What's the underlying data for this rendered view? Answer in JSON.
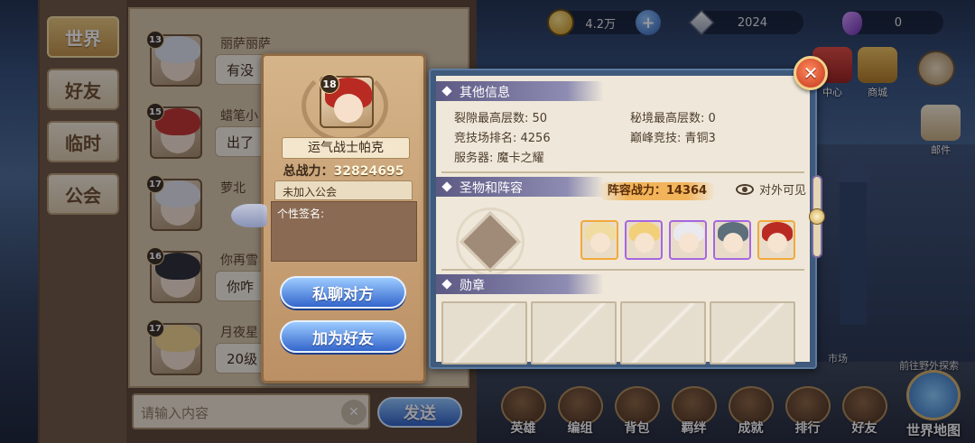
{
  "top_bar": {
    "gold": "4.2万",
    "diamonds": "2024",
    "purple_currency": "0"
  },
  "chat": {
    "tabs": [
      "世界",
      "好友",
      "临时",
      "公会"
    ],
    "active_tab_index": 0,
    "messages": [
      {
        "level": "13",
        "name": "丽萨丽萨",
        "text": "有没",
        "hair_color": "#dfe3ea"
      },
      {
        "level": "15",
        "name": "蜡笔小",
        "text": "出了",
        "hair_color": "#c4332b"
      },
      {
        "level": "17",
        "name": "萝北",
        "text": "",
        "hair_color": "#e4e4ea"
      },
      {
        "level": "16",
        "name": "你再雪",
        "text": "你咋",
        "hair_color": "#2c2c34"
      },
      {
        "level": "17",
        "name": "月夜星",
        "text": "20级",
        "hair_color": "#f1d58a"
      }
    ],
    "input_placeholder": "请输入内容",
    "send_label": "发送"
  },
  "profile": {
    "level": "18",
    "name": "运气战士帕克",
    "power_label": "总战力：",
    "power_value": "32824695",
    "guild": "未加入公会",
    "signature_label": "个性签名:",
    "private_chat_label": "私聊对方",
    "add_friend_label": "加为好友"
  },
  "info": {
    "other_title": "其他信息",
    "stats": {
      "rift_label": "裂隙最高层数: 50",
      "secret_label": "秘境最高层数: 0",
      "arena_label": "竞技场排名: 4256",
      "peak_label": "巅峰竞技: 青铜3",
      "server_label": "服务器: 魔卡之耀"
    },
    "lineup_title": "圣物和阵容",
    "team_power": "阵容战力：14364",
    "visibility": "对外可见",
    "heroes": [
      {
        "hair": "#f0dca0",
        "frame": "orange"
      },
      {
        "hair": "#f2d07a",
        "frame": "purple"
      },
      {
        "hair": "#e9e9ef",
        "frame": "purple"
      },
      {
        "hair": "#5c6f7a",
        "frame": "purple"
      },
      {
        "hair": "#b92a22",
        "frame": "orange"
      }
    ],
    "medal_title": "勋章",
    "medal_slots": 4
  },
  "bottom_menu": [
    "英雄",
    "编组",
    "背包",
    "羁绊",
    "成就",
    "排行",
    "好友"
  ],
  "world_map": "世界地图",
  "explore": "前往野外探索",
  "market": "市场",
  "side_buttons": [
    "中心",
    "商城",
    "邮件"
  ],
  "colors": {
    "accent_blue": "#3366cc",
    "panel_cream": "#efe8da",
    "close_red": "#c2341c"
  }
}
